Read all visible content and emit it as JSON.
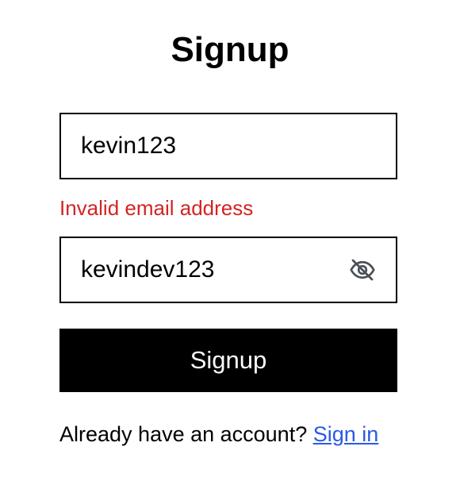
{
  "form": {
    "title": "Signup",
    "username": {
      "value": "kevin123",
      "error": "Invalid email address"
    },
    "password": {
      "value": "kevindev123",
      "toggle_icon": "eye-off-icon"
    },
    "submit_label": "Signup",
    "footer": {
      "prompt": "Already have an account?",
      "link_label": "Sign in"
    }
  },
  "colors": {
    "error": "#d32424",
    "link": "#2b59e8",
    "button_bg": "#000000",
    "button_text": "#ffffff"
  }
}
